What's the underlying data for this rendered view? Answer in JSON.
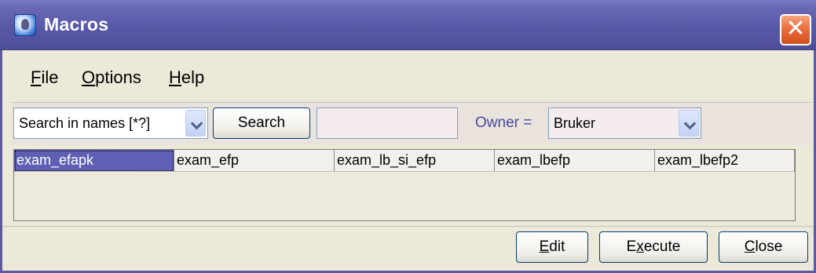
{
  "window": {
    "title": "Macros",
    "icon": "app-icon",
    "close_label": "✕"
  },
  "menu": [
    {
      "label": "File",
      "mnemonic": "F",
      "rest": "ile"
    },
    {
      "label": "Options",
      "mnemonic": "O",
      "rest": "ptions"
    },
    {
      "label": "Help",
      "mnemonic": "H",
      "rest": "elp"
    }
  ],
  "toolbar": {
    "search_mode": "Search in names [*?]",
    "search_button": "Search",
    "search_text": "",
    "owner_label": "Owner =",
    "owner_value": "Bruker"
  },
  "macros": [
    "exam_efapk",
    "exam_efp",
    "exam_lb_si_efp",
    "exam_lbefp",
    "exam_lbefp2"
  ],
  "selected_macro": "exam_efapk",
  "buttons": {
    "edit": {
      "mnemonic": "E",
      "rest": "dit"
    },
    "execute": {
      "pre": "E",
      "mnemonic": "x",
      "rest": "ecute"
    },
    "close": {
      "mnemonic": "C",
      "rest": "lose"
    }
  },
  "colors": {
    "title_bar": "#5858a8",
    "selection": "#5f5fb4",
    "close_button": "#e86a3a"
  }
}
